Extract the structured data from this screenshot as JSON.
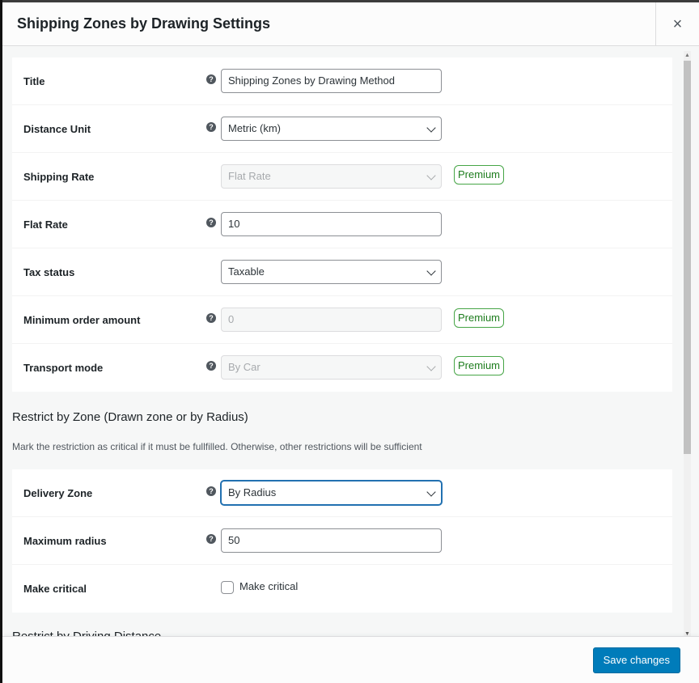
{
  "modal": {
    "title": "Shipping Zones by Drawing Settings",
    "close_icon": "×"
  },
  "general": {
    "rows": [
      {
        "label": "Title",
        "help": true,
        "type": "text",
        "value": "Shipping Zones by Drawing Method",
        "disabled": false,
        "premium": false
      },
      {
        "label": "Distance Unit",
        "help": true,
        "type": "select",
        "value": "Metric (km)",
        "disabled": false,
        "premium": false
      },
      {
        "label": "Shipping Rate",
        "help": false,
        "type": "select",
        "value": "Flat Rate",
        "disabled": true,
        "premium": true
      },
      {
        "label": "Flat Rate",
        "help": true,
        "type": "text",
        "value": "10",
        "disabled": false,
        "premium": false
      },
      {
        "label": "Tax status",
        "help": false,
        "type": "select",
        "value": "Taxable",
        "disabled": false,
        "premium": false
      },
      {
        "label": "Minimum order amount",
        "help": true,
        "type": "text",
        "value": "0",
        "disabled": true,
        "premium": true
      },
      {
        "label": "Transport mode",
        "help": true,
        "type": "select",
        "value": "By Car",
        "disabled": true,
        "premium": true
      }
    ]
  },
  "zone_section": {
    "title": "Restrict by Zone (Drawn zone or by Radius)",
    "description": "Mark the restriction as critical if it must be fullfilled. Otherwise, other restrictions will be sufficient",
    "delivery_zone": {
      "label": "Delivery Zone",
      "value": "By Radius"
    },
    "maximum_radius": {
      "label": "Maximum radius",
      "value": "50"
    },
    "make_critical": {
      "label": "Make critical",
      "checkbox_label": "Make critical",
      "checked": false
    }
  },
  "next_section": {
    "title": "Restrict by Driving Distance"
  },
  "premium_label": "Premium",
  "help_glyph": "?",
  "footer": {
    "save_label": "Save changes"
  },
  "colors": {
    "primary": "#007cba",
    "premium": "#46a546",
    "focus": "#2271b1"
  }
}
